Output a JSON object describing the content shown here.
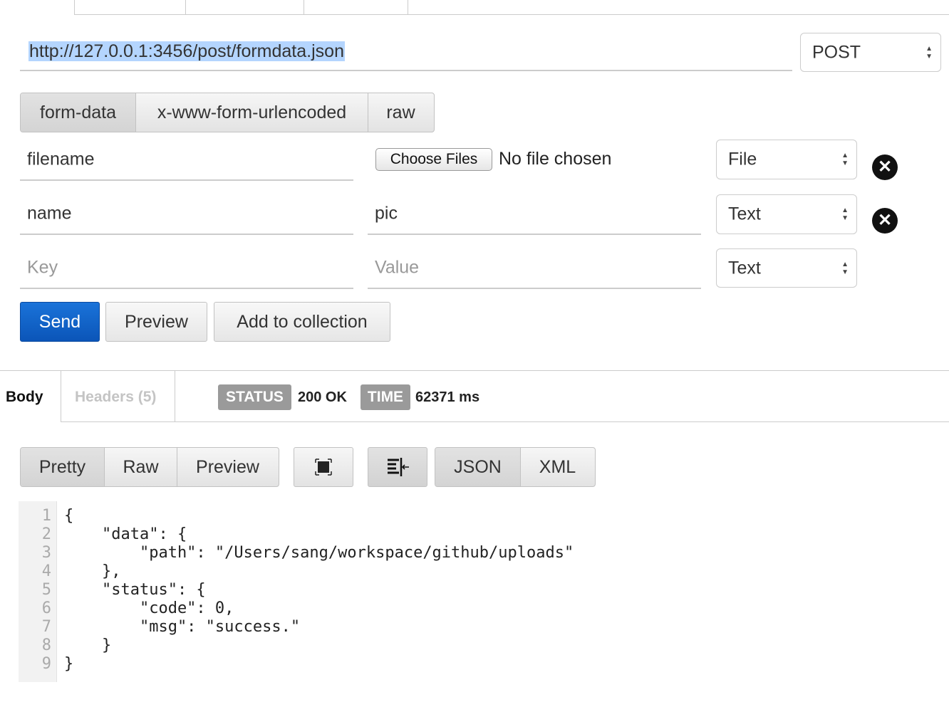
{
  "request": {
    "url": "http://127.0.0.1:3456/post/formdata.json",
    "method": "POST"
  },
  "body_mode_tabs": [
    "form-data",
    "x-www-form-urlencoded",
    "raw"
  ],
  "form_rows": [
    {
      "key": "filename",
      "choose_label": "Choose Files",
      "file_status": "No file chosen",
      "type": "File"
    },
    {
      "key": "name",
      "value": "pic",
      "type": "Text"
    },
    {
      "key_placeholder": "Key",
      "value_placeholder": "Value",
      "type": "Text"
    }
  ],
  "actions": {
    "send": "Send",
    "preview": "Preview",
    "add_to_collection": "Add to collection"
  },
  "response": {
    "tab_body": "Body",
    "tab_headers": "Headers (5)",
    "status_label": "STATUS",
    "status_value": "200 OK",
    "time_label": "TIME",
    "time_value": "62371 ms",
    "view_tabs": [
      "Pretty",
      "Raw",
      "Preview"
    ],
    "format_tabs": [
      "JSON",
      "XML"
    ]
  },
  "code_lines": [
    {
      "n": "1",
      "text": "{"
    },
    {
      "n": "2",
      "text": "    \"data\": {"
    },
    {
      "n": "3",
      "text": "        \"path\": \"/Users/sang/workspace/github/uploads\""
    },
    {
      "n": "4",
      "text": "    },"
    },
    {
      "n": "5",
      "text": "    \"status\": {"
    },
    {
      "n": "6",
      "text": "        \"code\": 0,"
    },
    {
      "n": "7",
      "text": "        \"msg\": \"success.\""
    },
    {
      "n": "8",
      "text": "    }"
    },
    {
      "n": "9",
      "text": "}"
    }
  ],
  "icons": {
    "remove": "remove-circle-icon",
    "fullscreen": "fullscreen-icon",
    "wrap": "wrap-lines-icon"
  },
  "colors": {
    "send": "#0b55b8",
    "selection": "#b4d5fe",
    "badge": "#9a9a9a"
  }
}
